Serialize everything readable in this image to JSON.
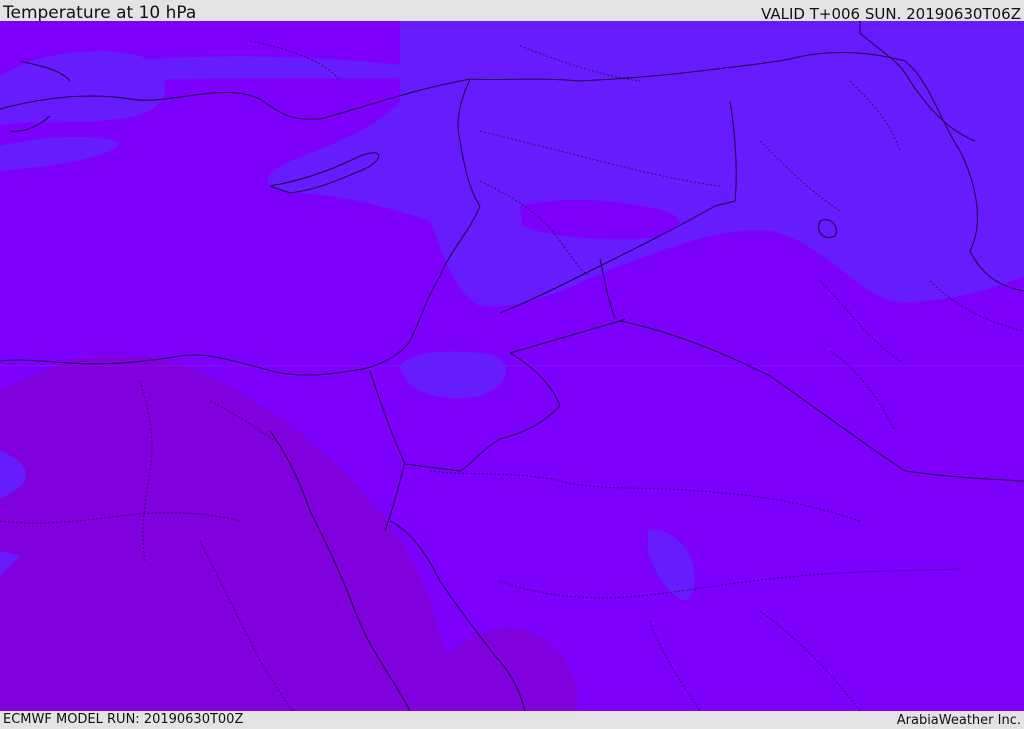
{
  "header": {
    "title": "Temperature at 10 hPa",
    "valid": "VALID T+006 SUN. 20190630T06Z"
  },
  "footer": {
    "model_run": "ECMWF MODEL RUN: 20190630T00Z",
    "credit": "ArabiaWeather Inc."
  },
  "map": {
    "colors": {
      "base": "#7c00fc",
      "warm_band": "#8000de",
      "cool_band": "#661cfc",
      "border": "#1a0840"
    }
  }
}
